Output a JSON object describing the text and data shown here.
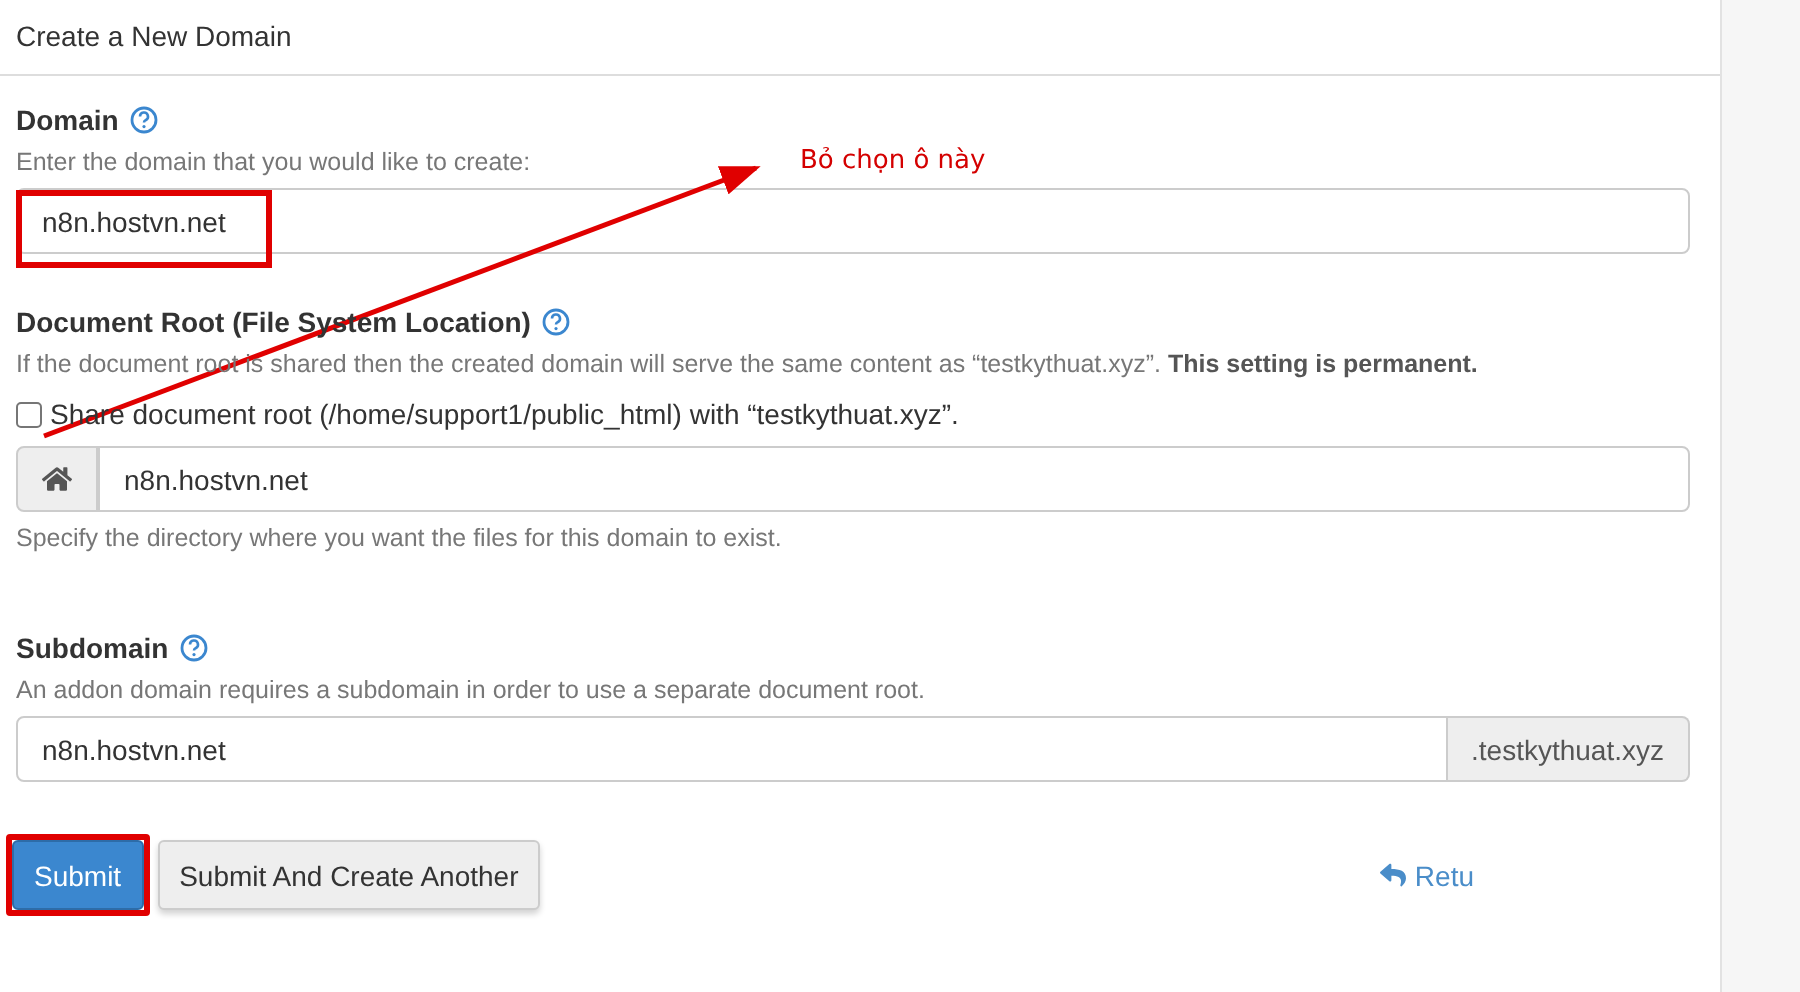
{
  "panel": {
    "title": "Create a New Domain"
  },
  "domain": {
    "label": "Domain",
    "hint": "Enter the domain that you would like to create:",
    "value": "n8n.hostvn.net",
    "highlighted": true
  },
  "document_root": {
    "label": "Document Root (File System Location)",
    "hint": "If the document root is shared then the created domain will serve the same content as “testkythuat.xyz”. **This setting is permanent.**",
    "share_checkbox": {
      "label": "Share document root (/home/support1/public_html) with “testkythuat.xyz”.",
      "checked": false
    },
    "value": "n8n.hostvn.net",
    "help": "Specify the directory where you want the files for this domain to exist."
  },
  "subdomain": {
    "label": "Subdomain",
    "hint": "An addon domain requires a subdomain in order to use a separate document root.",
    "value": "n8n.hostvn.net",
    "suffix": ".testkythuat.xyz"
  },
  "buttons": [
    {
      "label": "Submit",
      "kind": "primary",
      "highlighted": true
    },
    {
      "label": "Submit And Create Another",
      "kind": "default",
      "highlighted": false
    }
  ],
  "return_link": "Retu",
  "annotation": {
    "text": "Bỏ chọn ô này"
  }
}
